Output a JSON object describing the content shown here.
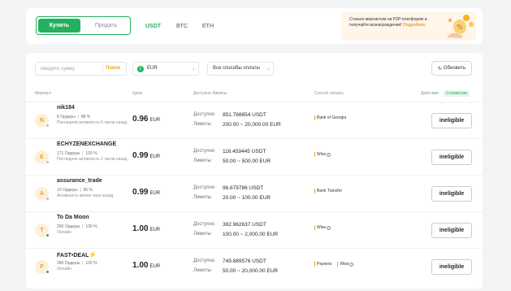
{
  "trade_tabs": {
    "buy": "Купить",
    "sell": "Продать"
  },
  "crypto_tabs": [
    "USDT",
    "BTC",
    "ETH"
  ],
  "promo": {
    "text": "Станьте мерчантом на P2P-платформе и получайте вознаграждения!",
    "link": "Подробнее"
  },
  "filters": {
    "amount_placeholder": "Введите сумму",
    "search_button": "Поиск",
    "currency": "EUR",
    "payment_method": "Все способы оплаты",
    "refresh": "Обновить"
  },
  "columns": {
    "merchant": "Мерчант",
    "price": "Цена",
    "available_limits": "Доступно  Лимиты",
    "payment": "Способ оплаты",
    "actions": "Действие",
    "zero_fee": "0 комиссии"
  },
  "status_colors": {
    "online": "#25b05f",
    "offline": "#b8bcc2"
  },
  "offers": [
    {
      "initial": "N",
      "name": "nik184",
      "online": false,
      "orders": "8 Ордеры",
      "completion": "88 %",
      "activity": "Последняя активность 6 часов назад",
      "price": "0.96",
      "currency": "EUR",
      "available_label": "Доступно",
      "available": "851.788854 USDT",
      "limits_label": "Лимиты",
      "limits": "200.00 ~ 20,000.00 EUR",
      "methods": [
        "Bank of Georgia"
      ],
      "info_after": [
        false
      ],
      "action": "ineligible"
    },
    {
      "initial": "E",
      "name": "ECHYZENEXCHANGE",
      "online": false,
      "orders": "171 Ордеры",
      "completion": "100 %",
      "activity": "Последняя активность 2 часов назад",
      "price": "0.99",
      "currency": "EUR",
      "available_label": "Доступно",
      "available": "116.459445 USDT",
      "limits_label": "Лимиты",
      "limits": "50.00 ~ 500.00 EUR",
      "methods": [
        "Wise"
      ],
      "info_after": [
        true
      ],
      "action": "ineligible"
    },
    {
      "initial": "A",
      "name": "assurance_trade",
      "online": false,
      "orders": "10 Ордеры",
      "completion": "90 %",
      "activity": "Активность менее часа назад",
      "price": "0.99",
      "currency": "EUR",
      "available_label": "Доступно",
      "available": "96.679786 USDT",
      "limits_label": "Лимиты",
      "limits": "20.00 ~ 100.00 EUR",
      "methods": [
        "Bank Transfer"
      ],
      "info_after": [
        false
      ],
      "action": "ineligible"
    },
    {
      "initial": "T",
      "name": "To Da Moon",
      "online": true,
      "orders": "260 Ордеры",
      "completion": "100 %",
      "activity": "Онлайн",
      "price": "1.00",
      "currency": "EUR",
      "available_label": "Доступно",
      "available": "382.962637 USDT",
      "limits_label": "Лимиты",
      "limits": "100.00 ~ 2,000.00 EUR",
      "methods": [
        "Wise"
      ],
      "info_after": [
        true
      ],
      "action": "ineligible"
    },
    {
      "initial": "F",
      "name": "FAST•DEAL",
      "online": true,
      "bolt": "⚡",
      "orders": "280 Ордеры",
      "completion": "100 %",
      "activity": "Онлайн",
      "price": "1.00",
      "currency": "EUR",
      "available_label": "Доступно",
      "available": "749.889576 USDT",
      "limits_label": "Лимиты",
      "limits": "50.00 ~ 20,000.00 EUR",
      "methods": [
        "Paysera",
        "Wise"
      ],
      "info_after": [
        false,
        true
      ],
      "action": "ineligible"
    }
  ]
}
